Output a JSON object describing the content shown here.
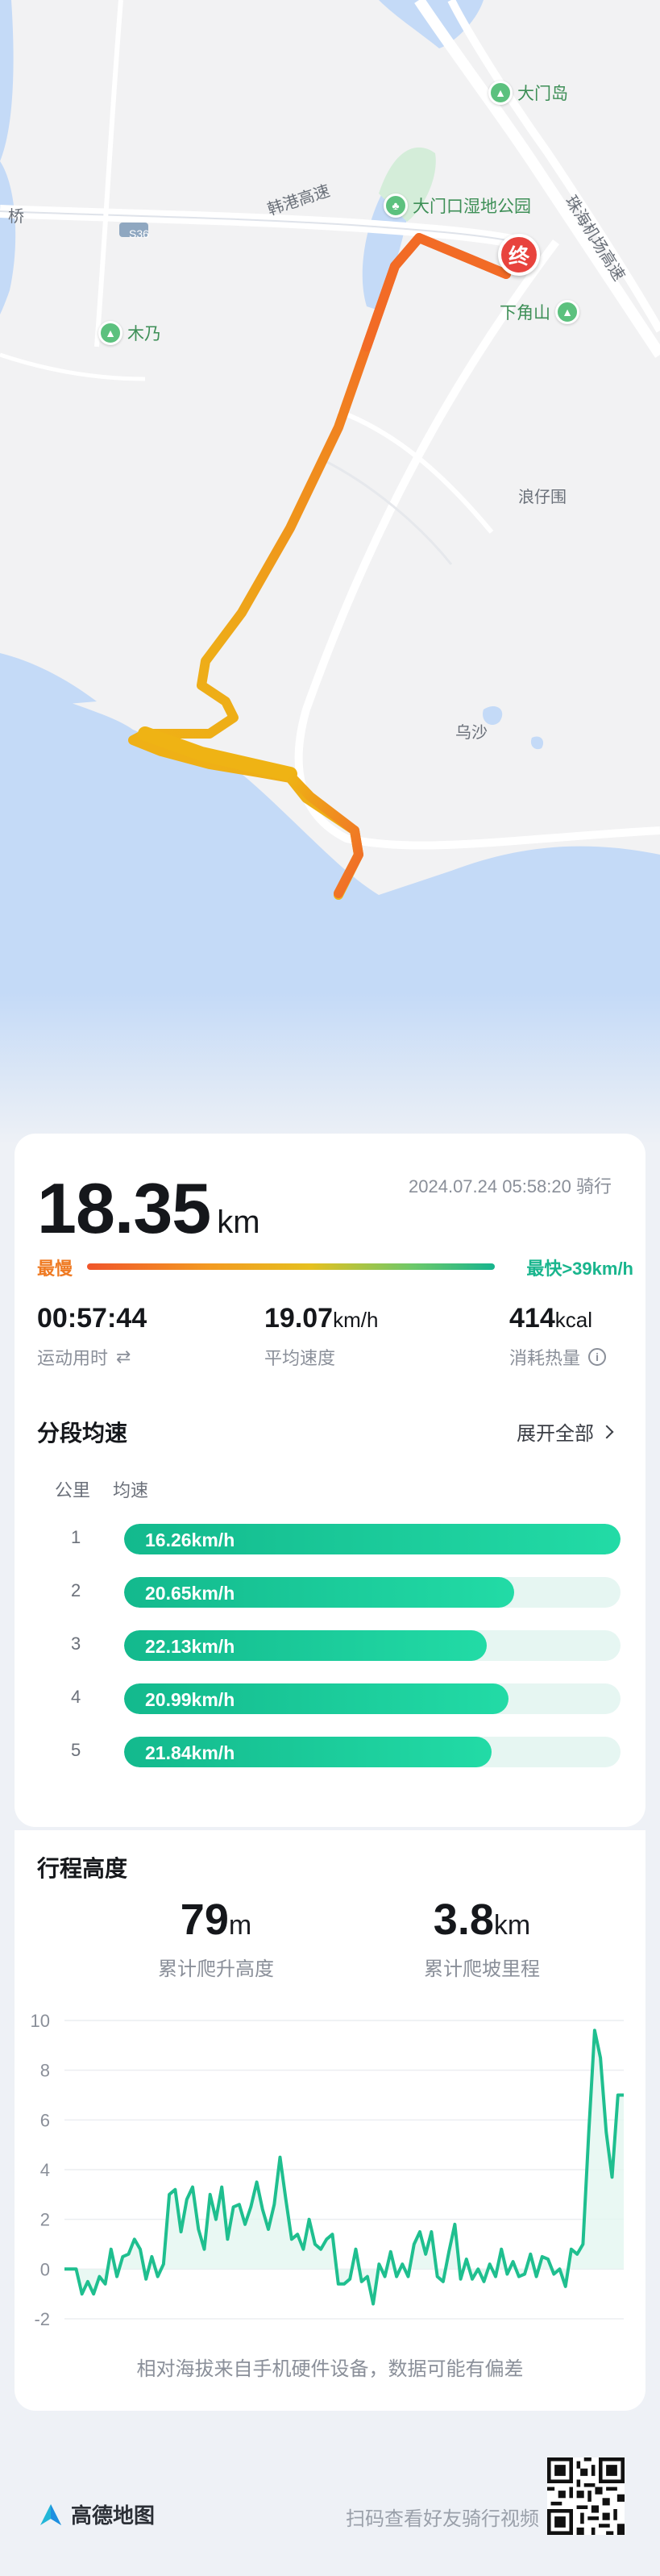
{
  "map": {
    "labels": {
      "damen_island": "大门岛",
      "wetland_park": "大门口湿地公园",
      "end_marker": "终",
      "xiajiaoshan": "下角山",
      "muyi": "木乃",
      "langzaiwei": "浪仔围",
      "wusha": "乌沙",
      "qiao": "桥",
      "road_hegang": "韩港高速",
      "road_zhuhai_airport": "珠海机场高速",
      "road_badge": "S36"
    }
  },
  "summary": {
    "distance": "18.35",
    "distance_unit": "km",
    "date": "2024.07.24 05:58:20 骑行",
    "slowest_label": "最慢",
    "fastest_label": "最快>39km/h",
    "duration": "00:57:44",
    "duration_label": "运动用时",
    "avg_speed": "19.07",
    "avg_speed_unit": "km/h",
    "avg_speed_label": "平均速度",
    "calories": "414",
    "calories_unit": "kcal",
    "calories_label": "消耗热量"
  },
  "segments": {
    "title": "分段均速",
    "expand_label": "展开全部",
    "col_km": "公里",
    "col_speed": "均速",
    "rows": [
      {
        "km": "1",
        "speed": "16.26km/h",
        "fill": 1.0
      },
      {
        "km": "2",
        "speed": "20.65km/h",
        "fill": 0.785
      },
      {
        "km": "3",
        "speed": "22.13km/h",
        "fill": 0.73
      },
      {
        "km": "4",
        "speed": "20.99km/h",
        "fill": 0.775
      },
      {
        "km": "5",
        "speed": "21.84km/h",
        "fill": 0.74
      }
    ]
  },
  "elevation": {
    "title": "行程高度",
    "climb": "79",
    "climb_unit": "m",
    "climb_label": "累计爬升高度",
    "slope_distance": "3.8",
    "slope_unit": "km",
    "slope_label": "累计爬坡里程",
    "note": "相对海拔来自手机硬件设备，数据可能有偏差"
  },
  "chart_data": {
    "type": "line",
    "ylim": [
      -2,
      10
    ],
    "yticks": [
      "10",
      "8",
      "6",
      "4",
      "2",
      "0",
      "-2"
    ],
    "series": [
      {
        "color": "#1fbf8f",
        "values": [
          0,
          0,
          0,
          -1,
          -0.5,
          -1,
          -0.3,
          -0.6,
          0.8,
          -0.3,
          0.5,
          0.6,
          1.2,
          0.8,
          -0.4,
          0.5,
          -0.3,
          0.2,
          3,
          3.2,
          1.5,
          2.8,
          3.3,
          1.6,
          0.8,
          3,
          2,
          3.3,
          1.2,
          2.5,
          2.6,
          1.8,
          2.5,
          3.5,
          2.4,
          1.6,
          2.6,
          4.5,
          2.8,
          1.2,
          1.4,
          0.8,
          2,
          1,
          0.8,
          1.2,
          1.4,
          -0.6,
          -0.6,
          -0.4,
          0.8,
          -0.5,
          -0.3,
          -1.4,
          0.2,
          -0.3,
          0.7,
          -0.3,
          0.2,
          -0.3,
          1,
          1.5,
          0.6,
          1.5,
          -0.3,
          -0.5,
          0.7,
          1.8,
          -0.4,
          0.4,
          -0.4,
          0,
          -0.5,
          0.2,
          -0.3,
          0.8,
          -0.2,
          0.3,
          -0.3,
          -0.2,
          0.6,
          -0.3,
          0.5,
          0.4,
          -0.2,
          0,
          -0.7,
          0.8,
          0.6,
          1,
          5.5,
          9.6,
          8.5,
          5.5,
          3.7,
          7,
          7
        ]
      }
    ]
  },
  "footer": {
    "brand": "高德地图",
    "scan_text": "扫码查看好友骑行视频"
  }
}
